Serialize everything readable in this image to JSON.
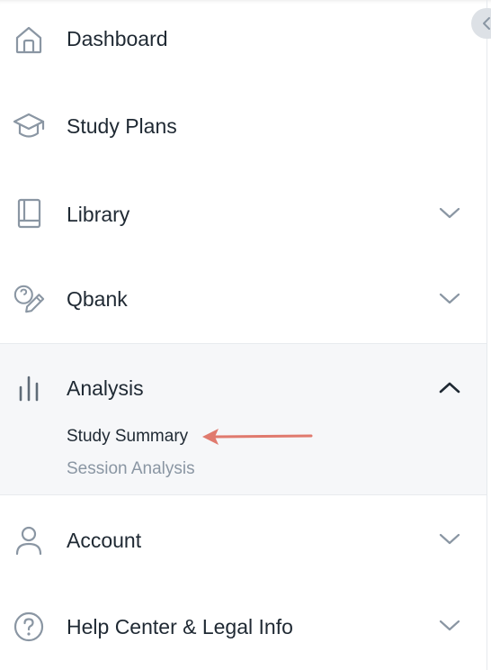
{
  "nav": {
    "dashboard": {
      "label": "Dashboard",
      "icon": "home-icon"
    },
    "study_plans": {
      "label": "Study Plans",
      "icon": "graduation-cap-icon"
    },
    "library": {
      "label": "Library",
      "icon": "book-icon",
      "chevron": "chevron-down-icon"
    },
    "qbank": {
      "label": "Qbank",
      "icon": "qbank-pencil-icon",
      "chevron": "chevron-down-icon"
    },
    "analysis": {
      "label": "Analysis",
      "icon": "bar-chart-icon",
      "chevron": "chevron-up-icon",
      "expanded": true,
      "sub_items": [
        {
          "label": "Study Summary",
          "active": true
        },
        {
          "label": "Session Analysis",
          "active": false
        }
      ]
    },
    "account": {
      "label": "Account",
      "icon": "user-icon",
      "chevron": "chevron-down-icon"
    },
    "help": {
      "label": "Help Center & Legal Info",
      "icon": "help-circle-icon",
      "chevron": "chevron-down-icon"
    }
  },
  "collapse_button": {
    "icon": "chevron-left-icon"
  },
  "annotation": {
    "icon": "red-arrow-left-icon",
    "color": "#e07a6e"
  },
  "colors": {
    "text": "#1f2933",
    "icon": "#8a96a3",
    "muted_text": "#8a96a3",
    "expanded_bg": "#f6f7f9"
  }
}
